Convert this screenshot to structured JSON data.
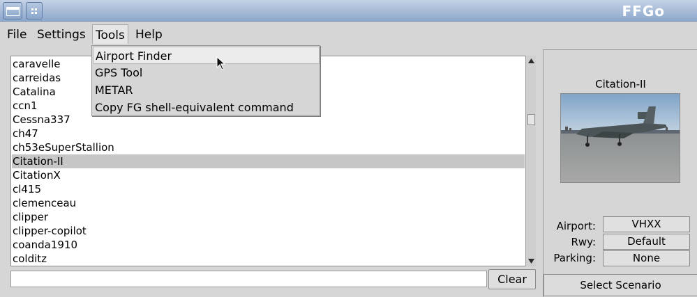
{
  "window": {
    "title": "FFGo"
  },
  "menubar": {
    "items": [
      "File",
      "Settings",
      "Tools",
      "Help"
    ]
  },
  "tools_menu": {
    "items": [
      "Airport Finder",
      "GPS Tool",
      "METAR",
      "Copy FG shell-equivalent command"
    ],
    "hovered": "Airport Finder"
  },
  "aircraft_list": {
    "items": [
      "caravelle",
      "carreidas",
      "Catalina",
      "ccn1",
      "Cessna337",
      "ch47",
      "ch53eSuperStallion",
      "Citation-II",
      "CitationX",
      "cl415",
      "clemenceau",
      "clipper",
      "clipper-copilot",
      "coanda1910",
      "colditz"
    ],
    "selected": "Citation-II"
  },
  "search": {
    "value": "",
    "clear_label": "Clear"
  },
  "details": {
    "aircraft_name": "Citation-II",
    "airport_label": "Airport:",
    "airport_value": "VHXX",
    "rwy_label": "Rwy:",
    "rwy_value": "Default",
    "parking_label": "Parking:",
    "parking_value": "None",
    "scenario_label": "Select Scenario"
  },
  "colors": {
    "titlebar": "#8da8cc",
    "selection": "#c6c6c6",
    "background": "#d6d6d6"
  }
}
